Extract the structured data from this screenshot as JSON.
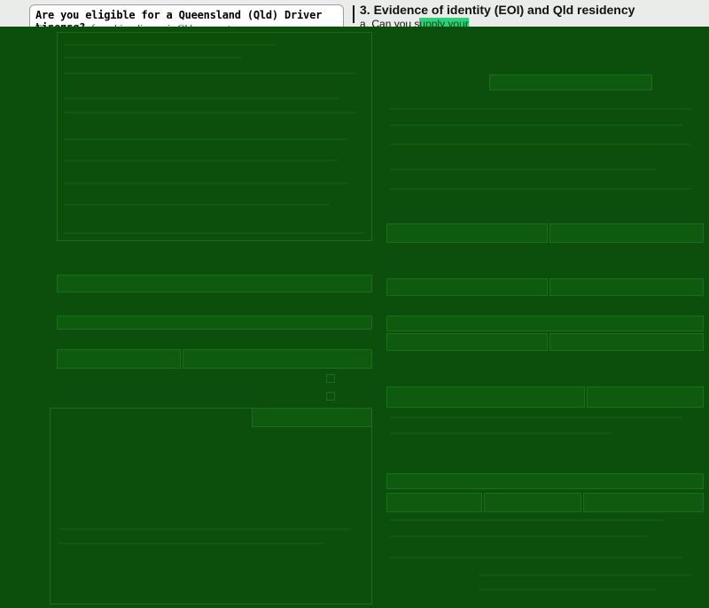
{
  "eligibility_box": {
    "title": "Are you eligible for a Queensland (Qld) Driver Licence?",
    "subtitle": "To be eligible for a driver licence in Qld you must:"
  },
  "section3": {
    "title": "3. Evidence of identity (EOI) and Qld residency",
    "question_prefix": "a.",
    "question_text_before": "Can you s",
    "question_text_highlight": "upply your",
    "question_text_after": ""
  },
  "colors": {
    "overlay": "#0c4f0c",
    "highlight": "#2ad17a",
    "paper": "#e9ece9"
  }
}
